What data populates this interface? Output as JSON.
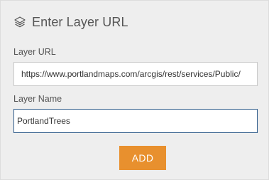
{
  "dialog": {
    "title": "Enter Layer URL",
    "header_icon": "layers-icon"
  },
  "layer_url": {
    "label": "Layer URL",
    "value": "https://www.portlandmaps.com/arcgis/rest/services/Public/"
  },
  "layer_name": {
    "label": "Layer Name",
    "value": "PortlandTrees"
  },
  "add_button": {
    "label": "ADD"
  },
  "colors": {
    "panel_background": "#eeeeee",
    "accent_button": "#e8902e",
    "focused_border": "#2e5b8a",
    "text": "#555555"
  }
}
